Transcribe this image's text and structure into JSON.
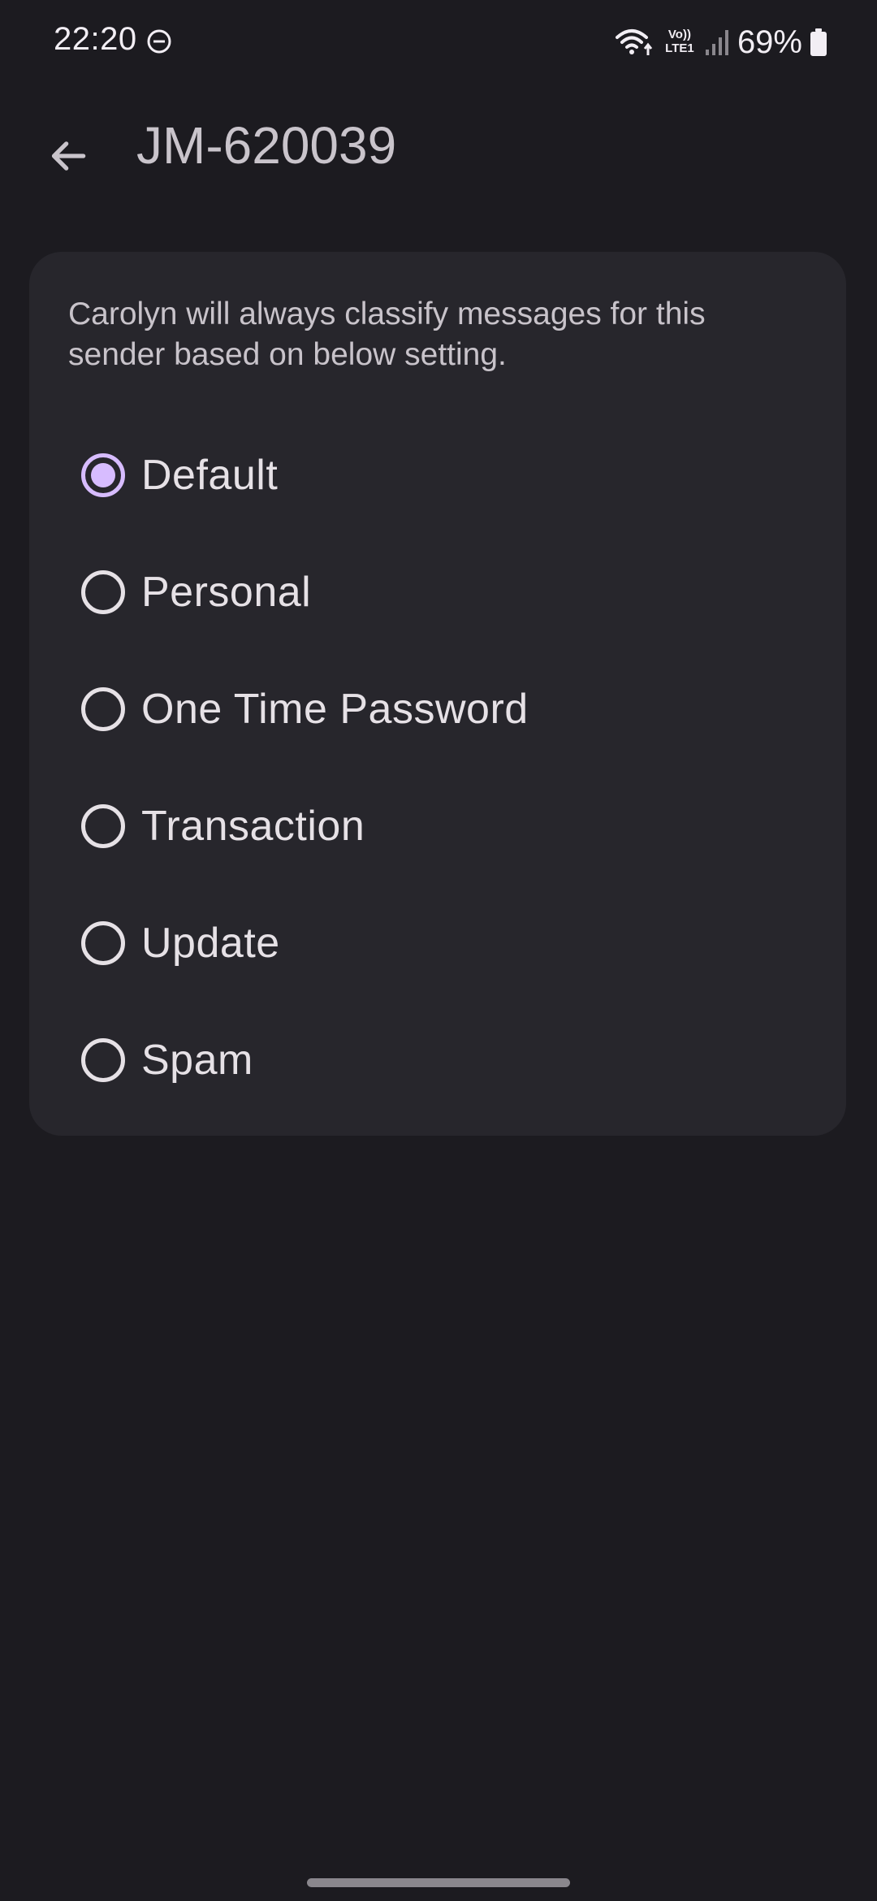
{
  "status_bar": {
    "time": "22:20",
    "dnd_icon": "do-not-disturb-icon",
    "wifi_icon": "wifi-icon",
    "volte_label_top": "Vo))",
    "volte_label_bottom": "LTE1",
    "signal_icon": "cellular-signal-icon",
    "battery_percent": "69%",
    "battery_icon": "battery-icon"
  },
  "app_bar": {
    "back_icon": "arrow-back-icon",
    "title": "JM-620039"
  },
  "card": {
    "description": "Carolyn will always classify messages for this sender based on below setting.",
    "options": [
      {
        "label": "Default",
        "selected": true
      },
      {
        "label": "Personal",
        "selected": false
      },
      {
        "label": "One Time Password",
        "selected": false
      },
      {
        "label": "Transaction",
        "selected": false
      },
      {
        "label": "Update",
        "selected": false
      },
      {
        "label": "Spam",
        "selected": false
      }
    ]
  },
  "colors": {
    "background": "#1c1b20",
    "card": "#27262c",
    "accent": "#d7bcff",
    "text_primary": "#e6e1e6",
    "text_secondary": "#c8c3ca"
  }
}
